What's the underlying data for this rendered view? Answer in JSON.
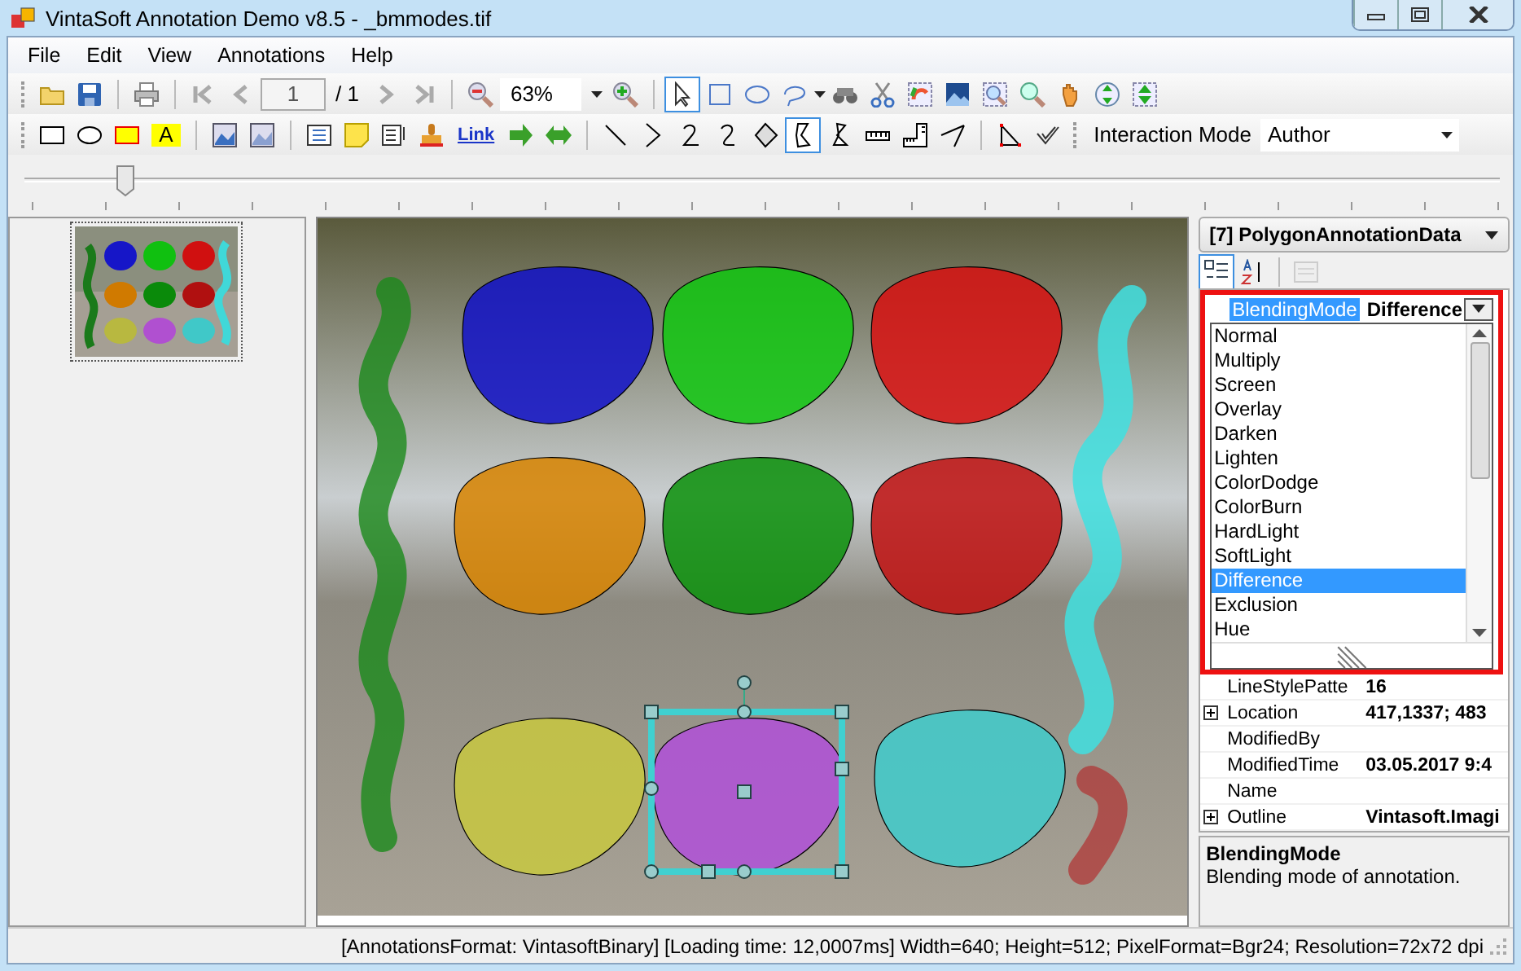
{
  "window": {
    "title": "VintaSoft Annotation Demo v8.5 - _bmmodes.tif"
  },
  "menu": [
    "File",
    "Edit",
    "View",
    "Annotations",
    "Help"
  ],
  "toolbar_1": {
    "page_field": {
      "value": "1"
    },
    "page_count": "/ 1",
    "zoom_field": {
      "value": "63%"
    },
    "tools": [
      {
        "selected": true
      },
      {
        "selected": false
      },
      {
        "selected": false
      },
      {
        "selected": false
      }
    ]
  },
  "toolbar_2": {
    "link": "Link",
    "text_tool": "A",
    "tools": [
      {
        "selected": false
      },
      {
        "selected": false
      },
      {
        "selected": false
      },
      {
        "selected": true
      },
      {
        "selected": false
      },
      {
        "selected": false
      }
    ],
    "interaction_mode": {
      "label": "Interaction Mode",
      "value": "Author"
    }
  },
  "property_panel": {
    "object_selector": "[7] PolygonAnnotationData",
    "editing": {
      "name": "BlendingMode",
      "value": "Difference"
    },
    "options": [
      {
        "label": "Normal",
        "selected": false
      },
      {
        "label": "Multiply",
        "selected": false
      },
      {
        "label": "Screen",
        "selected": false
      },
      {
        "label": "Overlay",
        "selected": false
      },
      {
        "label": "Darken",
        "selected": false
      },
      {
        "label": "Lighten",
        "selected": false
      },
      {
        "label": "ColorDodge",
        "selected": false
      },
      {
        "label": "ColorBurn",
        "selected": false
      },
      {
        "label": "HardLight",
        "selected": false
      },
      {
        "label": "SoftLight",
        "selected": false
      },
      {
        "label": "Difference",
        "selected": true
      },
      {
        "label": "Exclusion",
        "selected": false
      },
      {
        "label": "Hue",
        "selected": false
      }
    ],
    "rows": [
      {
        "name": "LineStylePatte",
        "value": "16",
        "expandable": false
      },
      {
        "name": "Location",
        "value": "417,1337; 483",
        "expandable": true
      },
      {
        "name": "ModifiedBy",
        "value": "",
        "expandable": false
      },
      {
        "name": "ModifiedTime",
        "value": "03.05.2017 9:4",
        "expandable": false
      },
      {
        "name": "Name",
        "value": "",
        "expandable": false
      },
      {
        "name": "Outline",
        "value": "Vintasoft.Imagi",
        "expandable": true
      }
    ],
    "description": {
      "title": "BlendingMode",
      "text": "Blending mode of annotation."
    }
  },
  "status_bar": "[AnnotationsFormat: VintasoftBinary] [Loading time: 12,0007ms]  Width=640; Height=512; PixelFormat=Bgr24; Resolution=72x72 dpi"
}
